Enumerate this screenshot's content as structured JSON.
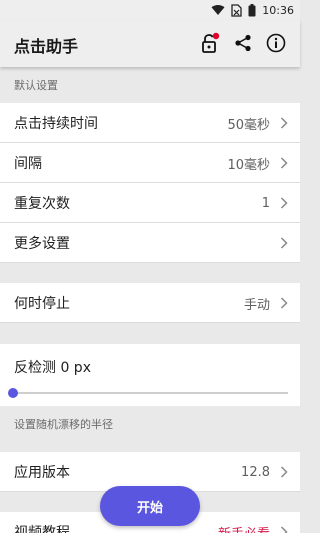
{
  "status_bar": {
    "time": "10:36"
  },
  "app_bar": {
    "title": "点击助手",
    "icons": [
      "lock-badge-icon",
      "share-icon",
      "info-icon"
    ]
  },
  "sections": {
    "default_settings_header": "默认设置",
    "random_drift_header": "设置随机漂移的半径"
  },
  "settings": {
    "click_duration": {
      "label": "点击持续时间",
      "value": "50毫秒"
    },
    "interval": {
      "label": "间隔",
      "value": "10毫秒"
    },
    "repeat_count": {
      "label": "重复次数",
      "value": "1"
    },
    "more_settings": {
      "label": "更多设置"
    },
    "stop_when": {
      "label": "何时停止",
      "value": "手动"
    },
    "anti_detection": {
      "label": "反检测 0 px",
      "level": 0
    },
    "app_version": {
      "label": "应用版本",
      "value": "12.8"
    },
    "video_tutorial": {
      "label": "视频教程",
      "value": "新手必看"
    }
  },
  "fab": {
    "label": "开始"
  },
  "colors": {
    "accent": "#5b56e0",
    "badge": "#e0002b",
    "highlight": "#d6194b",
    "background": "#e9e9e9",
    "app_bar": "#eeeeee"
  }
}
